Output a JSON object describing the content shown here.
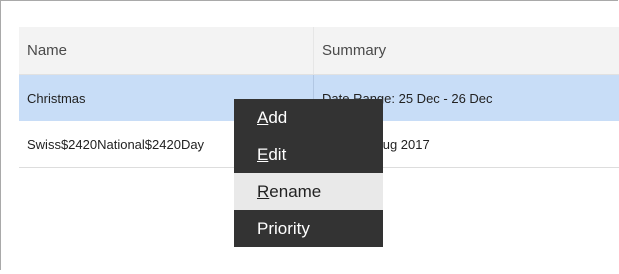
{
  "table": {
    "headers": {
      "name": "Name",
      "summary": "Summary"
    },
    "rows": [
      {
        "name": "Christmas",
        "summary": "Date Range: 25 Dec - 26 Dec",
        "selected": true
      },
      {
        "name": "Swiss$2420National$2420Day",
        "summary": "Date: 01 Aug 2017",
        "selected": false
      }
    ]
  },
  "context_menu": {
    "items": [
      {
        "mnemonic": "A",
        "rest": "dd",
        "highlighted": false
      },
      {
        "mnemonic": "E",
        "rest": "dit",
        "highlighted": false
      },
      {
        "mnemonic": "R",
        "rest": "ename",
        "highlighted": true
      },
      {
        "mnemonic": "",
        "rest": "Priority",
        "highlighted": false
      }
    ]
  },
  "colors": {
    "selected_row": "#c8ddf7",
    "menu_background": "#333333",
    "menu_highlight": "#e9e9e9"
  }
}
